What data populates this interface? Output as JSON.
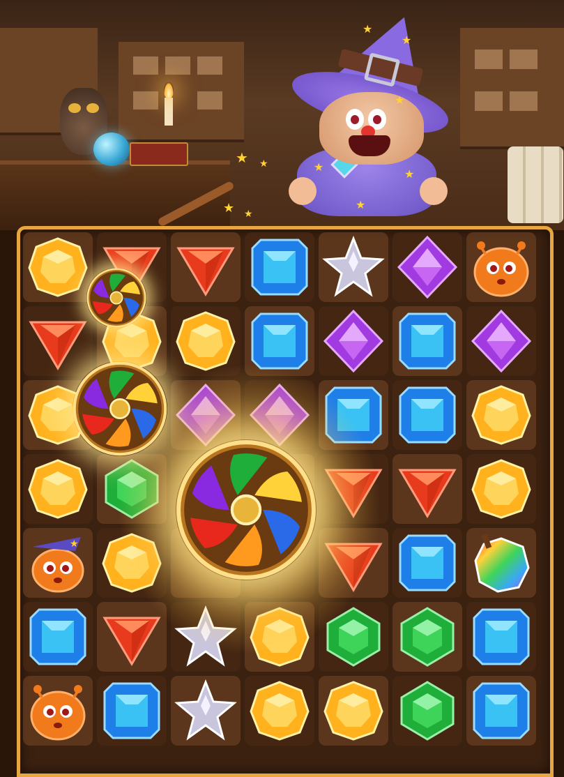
{
  "game": {
    "scene": "wizard-shop",
    "character": "wizard-monster",
    "character_icon": "wizard-icon"
  },
  "colors": {
    "board_border": "#e8a640",
    "board_bg": "#3b2110",
    "yellow": "#ffb21e",
    "red": "#e83a1c",
    "blue": "#1f7fe8",
    "purple": "#a23ae2",
    "green": "#1fae3a",
    "silver": "#c9c5dc",
    "orange_creature": "#f07a1c"
  },
  "board": {
    "rows": 7,
    "cols": 7,
    "grid": [
      [
        "yellow-gem",
        "red-gem",
        "red-gem",
        "blue-gem",
        "silver-star",
        "purple-gem",
        "orange-creature"
      ],
      [
        "red-gem",
        "yellow-gem",
        "yellow-gem",
        "blue-gem",
        "purple-gem",
        "blue-gem",
        "purple-gem"
      ],
      [
        "yellow-gem",
        "rainbow-wheel",
        "purple-gem",
        "purple-gem",
        "blue-gem",
        "blue-gem",
        "yellow-gem"
      ],
      [
        "yellow-gem",
        "green-gem",
        "rainbow-wheel",
        "rainbow-wheel",
        "red-gem",
        "red-gem",
        "yellow-gem"
      ],
      [
        "wizard-creature",
        "yellow-gem",
        "rainbow-wheel",
        "rainbow-wheel",
        "red-gem",
        "blue-gem",
        "rainbow-apple"
      ],
      [
        "blue-gem",
        "red-gem",
        "silver-star",
        "yellow-gem",
        "green-gem",
        "green-gem",
        "blue-gem"
      ],
      [
        "orange-creature",
        "blue-gem",
        "silver-star",
        "yellow-gem",
        "yellow-gem",
        "green-gem",
        "blue-gem"
      ]
    ]
  },
  "power_ups": [
    {
      "name": "rainbow-wheel-small"
    },
    {
      "name": "rainbow-wheel-medium"
    },
    {
      "name": "rainbow-wheel-large"
    }
  ]
}
